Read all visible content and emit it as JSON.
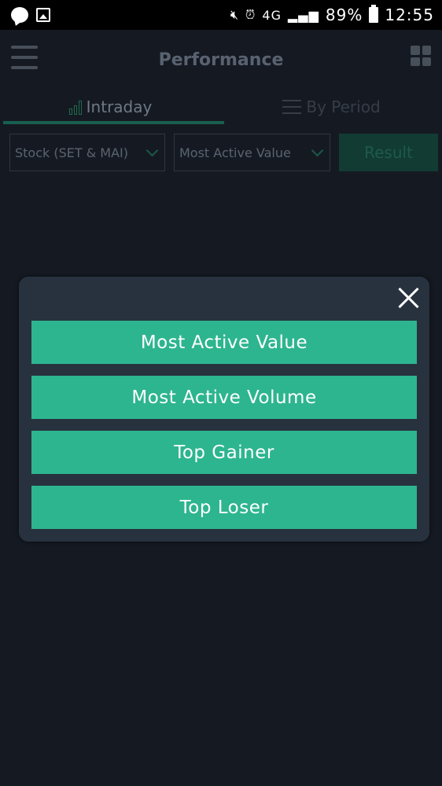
{
  "status_bar": {
    "icons_left": [
      "line-app-icon",
      "image-icon"
    ],
    "icons_right": [
      "mute-icon",
      "alarm-icon",
      "4g-icon",
      "signal-icon",
      "battery-icon"
    ],
    "network": "4G",
    "battery": "89%",
    "time": "12:55"
  },
  "app_bar": {
    "title": "Performance",
    "menu_icon": "hamburger-icon",
    "grid_icon": "grid-icon"
  },
  "tabs": [
    {
      "label": "Intraday",
      "icon": "chart-up-icon",
      "active": true
    },
    {
      "label": "By Period",
      "icon": "sliders-icon",
      "active": false
    }
  ],
  "filters": {
    "market": "Stock (SET & MAI)",
    "ranking": "Most Active Value",
    "result_label": "Result"
  },
  "modal": {
    "options": [
      "Most Active Value",
      "Most Active Volume",
      "Top Gainer",
      "Top Loser"
    ]
  },
  "colors": {
    "accent": "#2db58f",
    "modal_bg": "#28323e",
    "app_bg": "#151a22"
  }
}
